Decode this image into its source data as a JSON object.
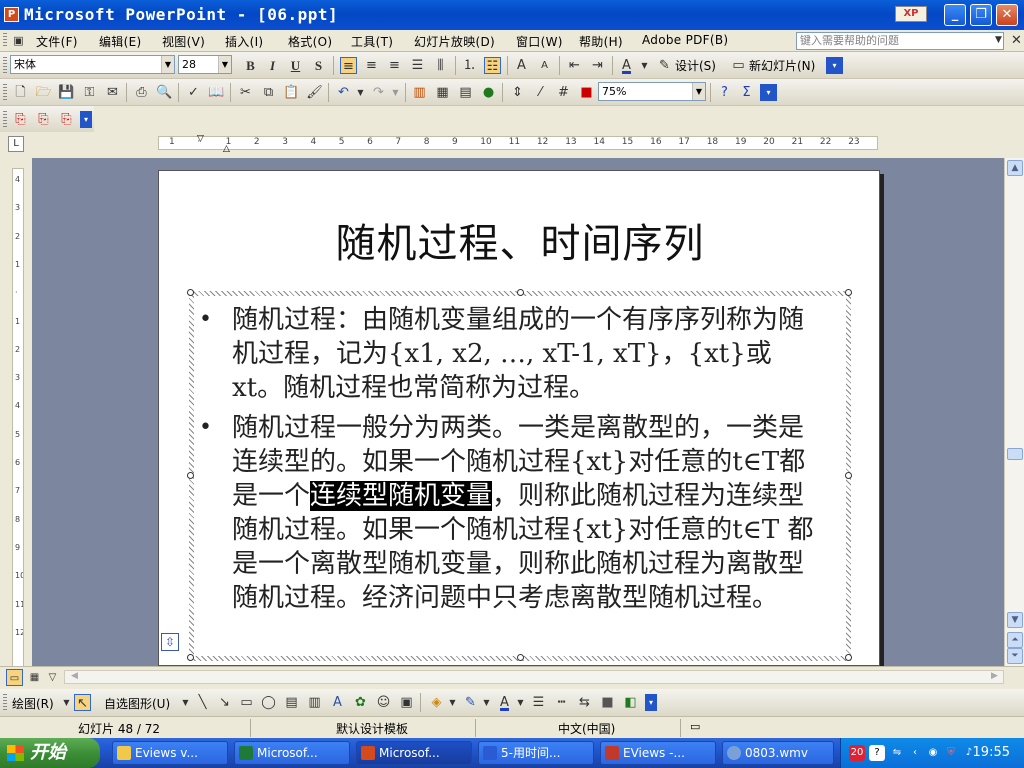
{
  "window": {
    "title": "Microsoft PowerPoint - [06.ppt]"
  },
  "menu": {
    "items": [
      "文件(F)",
      "编辑(E)",
      "视图(V)",
      "插入(I)",
      "格式(O)",
      "工具(T)",
      "幻灯片放映(D)",
      "窗口(W)",
      "帮助(H)",
      "Adobe PDF(B)"
    ],
    "help_placeholder": "键入需要帮助的问题"
  },
  "format_toolbar": {
    "font": "宋体",
    "size": "28",
    "design_label": "设计(S)",
    "new_slide_label": "新幻灯片(N)"
  },
  "standard_toolbar": {
    "zoom": "75%"
  },
  "ruler": {
    "h_ticks": [
      "1",
      "",
      "1",
      "2",
      "3",
      "4",
      "5",
      "6",
      "7",
      "8",
      "9",
      "10",
      "11",
      "12",
      "13",
      "14",
      "15",
      "16",
      "17",
      "18",
      "19",
      "20",
      "21",
      "22",
      "23"
    ],
    "v_ticks": [
      "4",
      "3",
      "2",
      "1",
      "",
      "1",
      "2",
      "3",
      "4",
      "5",
      "6",
      "7",
      "8",
      "9",
      "10",
      "11",
      "12"
    ]
  },
  "slide": {
    "title": "随机过程、时间序列",
    "bullets": [
      {
        "text_before": "随机过程：由随机变量组成的一个有序序列称为随机过程，记为{x1, x2, …, xT-1, xT}，{xt}或 xt。随机过程也常简称为过程。",
        "selected": "",
        "text_after": ""
      },
      {
        "text_before": "随机过程一般分为两类。一类是离散型的，一类是连续型的。如果一个随机过程{xt}对任意的t∈T都是一个",
        "selected": "连续型随机变量",
        "text_after": "，则称此随机过程为连续型随机过程。如果一个随机过程{xt}对任意的t∈T 都是一个离散型随机变量，则称此随机过程为离散型随机过程。经济问题中只考虑离散型随机过程。"
      }
    ]
  },
  "drawing_toolbar": {
    "draw_label": "绘图(R)",
    "autoshapes_label": "自选图形(U)"
  },
  "status": {
    "slide_info": "幻灯片 48 / 72",
    "template": "默认设计模板",
    "language": "中文(中国)"
  },
  "taskbar": {
    "start_label": "开始",
    "tasks": [
      "Eviews v...",
      "Microsof...",
      "Microsof...",
      "5-用时间...",
      "EViews -...",
      "0803.wmv"
    ],
    "clock": "19:55"
  },
  "colors": {
    "title_bar": "#0a5fd8",
    "workspace": "#7c879f",
    "taskbar": "#245edb",
    "start": "#3c8f36",
    "selection": "#000000"
  }
}
